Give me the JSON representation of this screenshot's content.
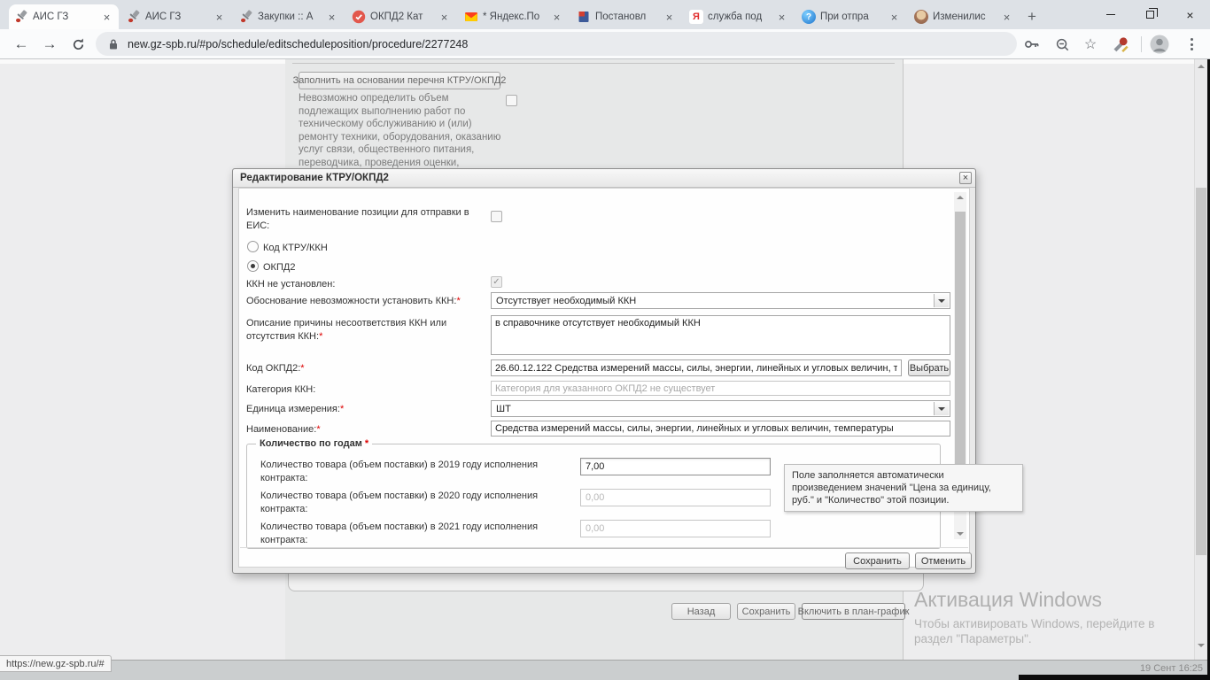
{
  "browser": {
    "tabs": [
      {
        "label": "АИС ГЗ",
        "icon": "gavel"
      },
      {
        "label": "АИС ГЗ",
        "icon": "gavel"
      },
      {
        "label": "Закупки :: А",
        "icon": "gavel"
      },
      {
        "label": "ОКПД2 Кат",
        "icon": "red-badge"
      },
      {
        "label": "* Яндекс.По",
        "icon": "yandex-mail"
      },
      {
        "label": "Постановл",
        "icon": "document"
      },
      {
        "label": "служба под",
        "icon": "yandex-ya"
      },
      {
        "label": "При отпра",
        "icon": "blue-question"
      },
      {
        "label": "Изменилис",
        "icon": "avatar"
      }
    ],
    "glyphs": {
      "close": "×",
      "new_tab": "+",
      "back": "←",
      "forward": "→",
      "star": "☆",
      "ya": "Я",
      "question": "?",
      "check": "✓"
    },
    "url": "new.gz-spb.ru/#po/schedule/editscheduleposition/procedure/2277248",
    "status_link": "https://new.gz-spb.ru/#",
    "clock": "19 Сент 16:25"
  },
  "page": {
    "fill_button": "Заполнить на основании перечня КТРУ/ОКПД2",
    "volume_note": "Невозможно определить объем подлежащих выполнению работ по техническому обслуживанию и (или) ремонту техники, оборудования, оказанию услуг связи, общественного питания, переводчика, проведения оценки, перевозки грузов, пассажиров и багажа, юридических",
    "buttons": {
      "back": "Назад",
      "save": "Сохранить",
      "include": "Включить в план-график"
    }
  },
  "watermark": {
    "title": "Активация Windows",
    "line1": "Чтобы активировать Windows, перейдите в",
    "line2": "раздел \"Параметры\"."
  },
  "modal": {
    "title": "Редактирование КТРУ/ОКПД2",
    "required_marker": "*",
    "fields": {
      "eis_label": "Изменить наименование позиции для отправки в ЕИС:",
      "radio_ktru": "Код КТРУ/ККН",
      "radio_okpd2": "ОКПД2",
      "kkn_label": "ККН не установлен:",
      "justification_label": "Обоснование невозможности установить ККН:",
      "justification_value": "Отсутствует необходимый ККН",
      "description_label": "Описание причины несоответствия ККН или отсутствия ККН:",
      "description_value": "в справочнике отсутствует необходимый ККН",
      "okpd2_label": "Код ОКПД2:",
      "okpd2_value": "26.60.12.122 Средства измерений массы, силы, энергии, линейных и угловых величин, темп",
      "okpd2_button": "Выбрать",
      "category_label": "Категория ККН:",
      "category_placeholder": "Категория для указанного ОКПД2 не существует",
      "unit_label": "Единица измерения:",
      "unit_value": "ШТ",
      "name_label": "Наименование:",
      "name_value": "Средства измерений массы, силы, энергии, линейных и угловых величин, температуры",
      "quantity_legend": "Количество по годам",
      "qty_rows": [
        {
          "label": "Количество товара (объем поставки) в 2019 году исполнения контракта:",
          "value": "7,00"
        },
        {
          "label": "Количество товара (объем поставки) в 2020 году исполнения контракта:",
          "value": "0,00"
        },
        {
          "label": "Количество товара (объем поставки) в 2021 году исполнения контракта:",
          "value": "0,00"
        }
      ]
    },
    "tooltip": "Поле заполняется автоматически произведением значений \"Цена за единицу, руб.\" и \"Количество\" этой позиции.",
    "buttons": {
      "save": "Сохранить",
      "cancel": "Отменить"
    }
  }
}
